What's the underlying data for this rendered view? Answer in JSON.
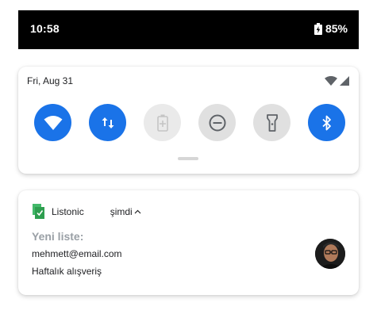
{
  "status_bar": {
    "time": "10:58",
    "battery_percent": "85%",
    "icons": [
      "battery-charging-icon"
    ]
  },
  "quick_settings": {
    "date": "Fri, Aug 31",
    "status_icons": [
      "wifi-signal-icon",
      "cell-signal-icon"
    ],
    "tiles": [
      {
        "name": "wifi",
        "icon": "wifi-icon",
        "state": "on"
      },
      {
        "name": "mobile-data",
        "icon": "data-arrows-icon",
        "state": "on"
      },
      {
        "name": "battery-saver",
        "icon": "battery-saver-icon",
        "state": "disabled"
      },
      {
        "name": "do-not-disturb",
        "icon": "dnd-icon",
        "state": "off"
      },
      {
        "name": "flashlight",
        "icon": "flashlight-icon",
        "state": "off"
      },
      {
        "name": "bluetooth",
        "icon": "bluetooth-icon",
        "state": "on"
      }
    ]
  },
  "notification": {
    "app_name": "Listonic",
    "app_icon": "listonic-app-icon",
    "time": "şimdi",
    "title": "Yeni liste:",
    "line1": "mehmett@email.com",
    "line2": "Haftalık alışveriş",
    "avatar": "user-avatar"
  },
  "colors": {
    "accent": "#1a73e8",
    "tile_off": "#e0e0e0",
    "title_gray": "#9aa0a6",
    "app_green": "#2e9e4f"
  }
}
